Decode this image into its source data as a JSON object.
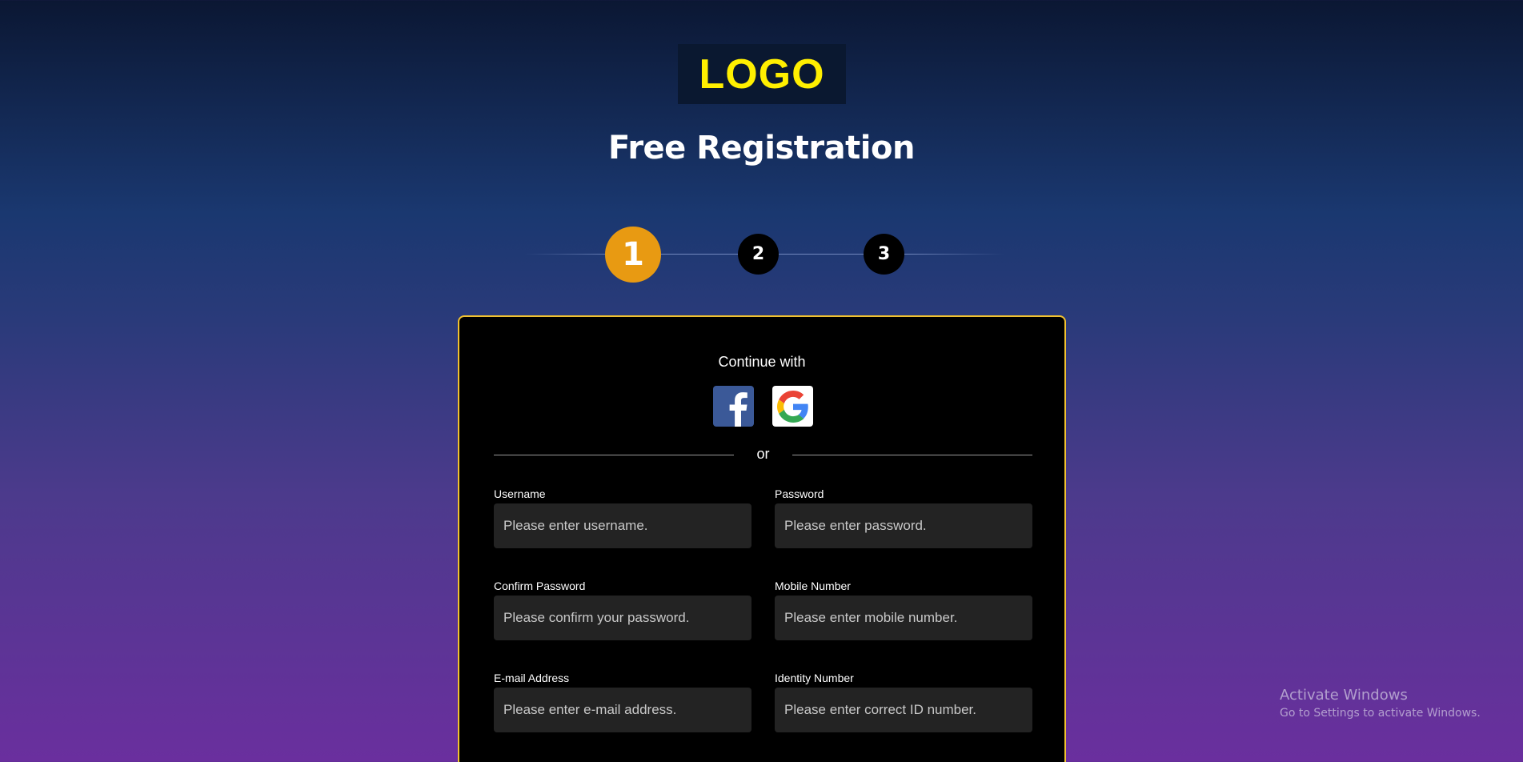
{
  "logo": {
    "text": "LOGO",
    "color": "#ffef00"
  },
  "page_title": "Free Registration",
  "steps": [
    {
      "label": "1",
      "active": true
    },
    {
      "label": "2",
      "active": false
    },
    {
      "label": "3",
      "active": false
    }
  ],
  "form": {
    "continue_with": "Continue with",
    "social": [
      {
        "name": "facebook",
        "icon": "facebook-icon"
      },
      {
        "name": "google",
        "icon": "google-icon"
      }
    ],
    "or_text": "or",
    "fields": {
      "username": {
        "label": "Username",
        "placeholder": "Please enter username."
      },
      "password": {
        "label": "Password",
        "placeholder": "Please enter password."
      },
      "confirm_password": {
        "label": "Confirm Password",
        "placeholder": "Please confirm your password."
      },
      "mobile": {
        "label": "Mobile Number",
        "placeholder": "Please enter mobile number."
      },
      "email": {
        "label": "E-mail Address",
        "placeholder": "Please enter e-mail address."
      },
      "identity": {
        "label": "Identity Number",
        "placeholder": "Please enter correct ID number."
      }
    }
  },
  "colors": {
    "accent_step": "#e89a12",
    "card_border": "#f2c230",
    "card_bg": "#000000",
    "input_bg": "#232323"
  },
  "watermark": {
    "title": "Activate Windows",
    "subtitle": "Go to Settings to activate Windows."
  }
}
